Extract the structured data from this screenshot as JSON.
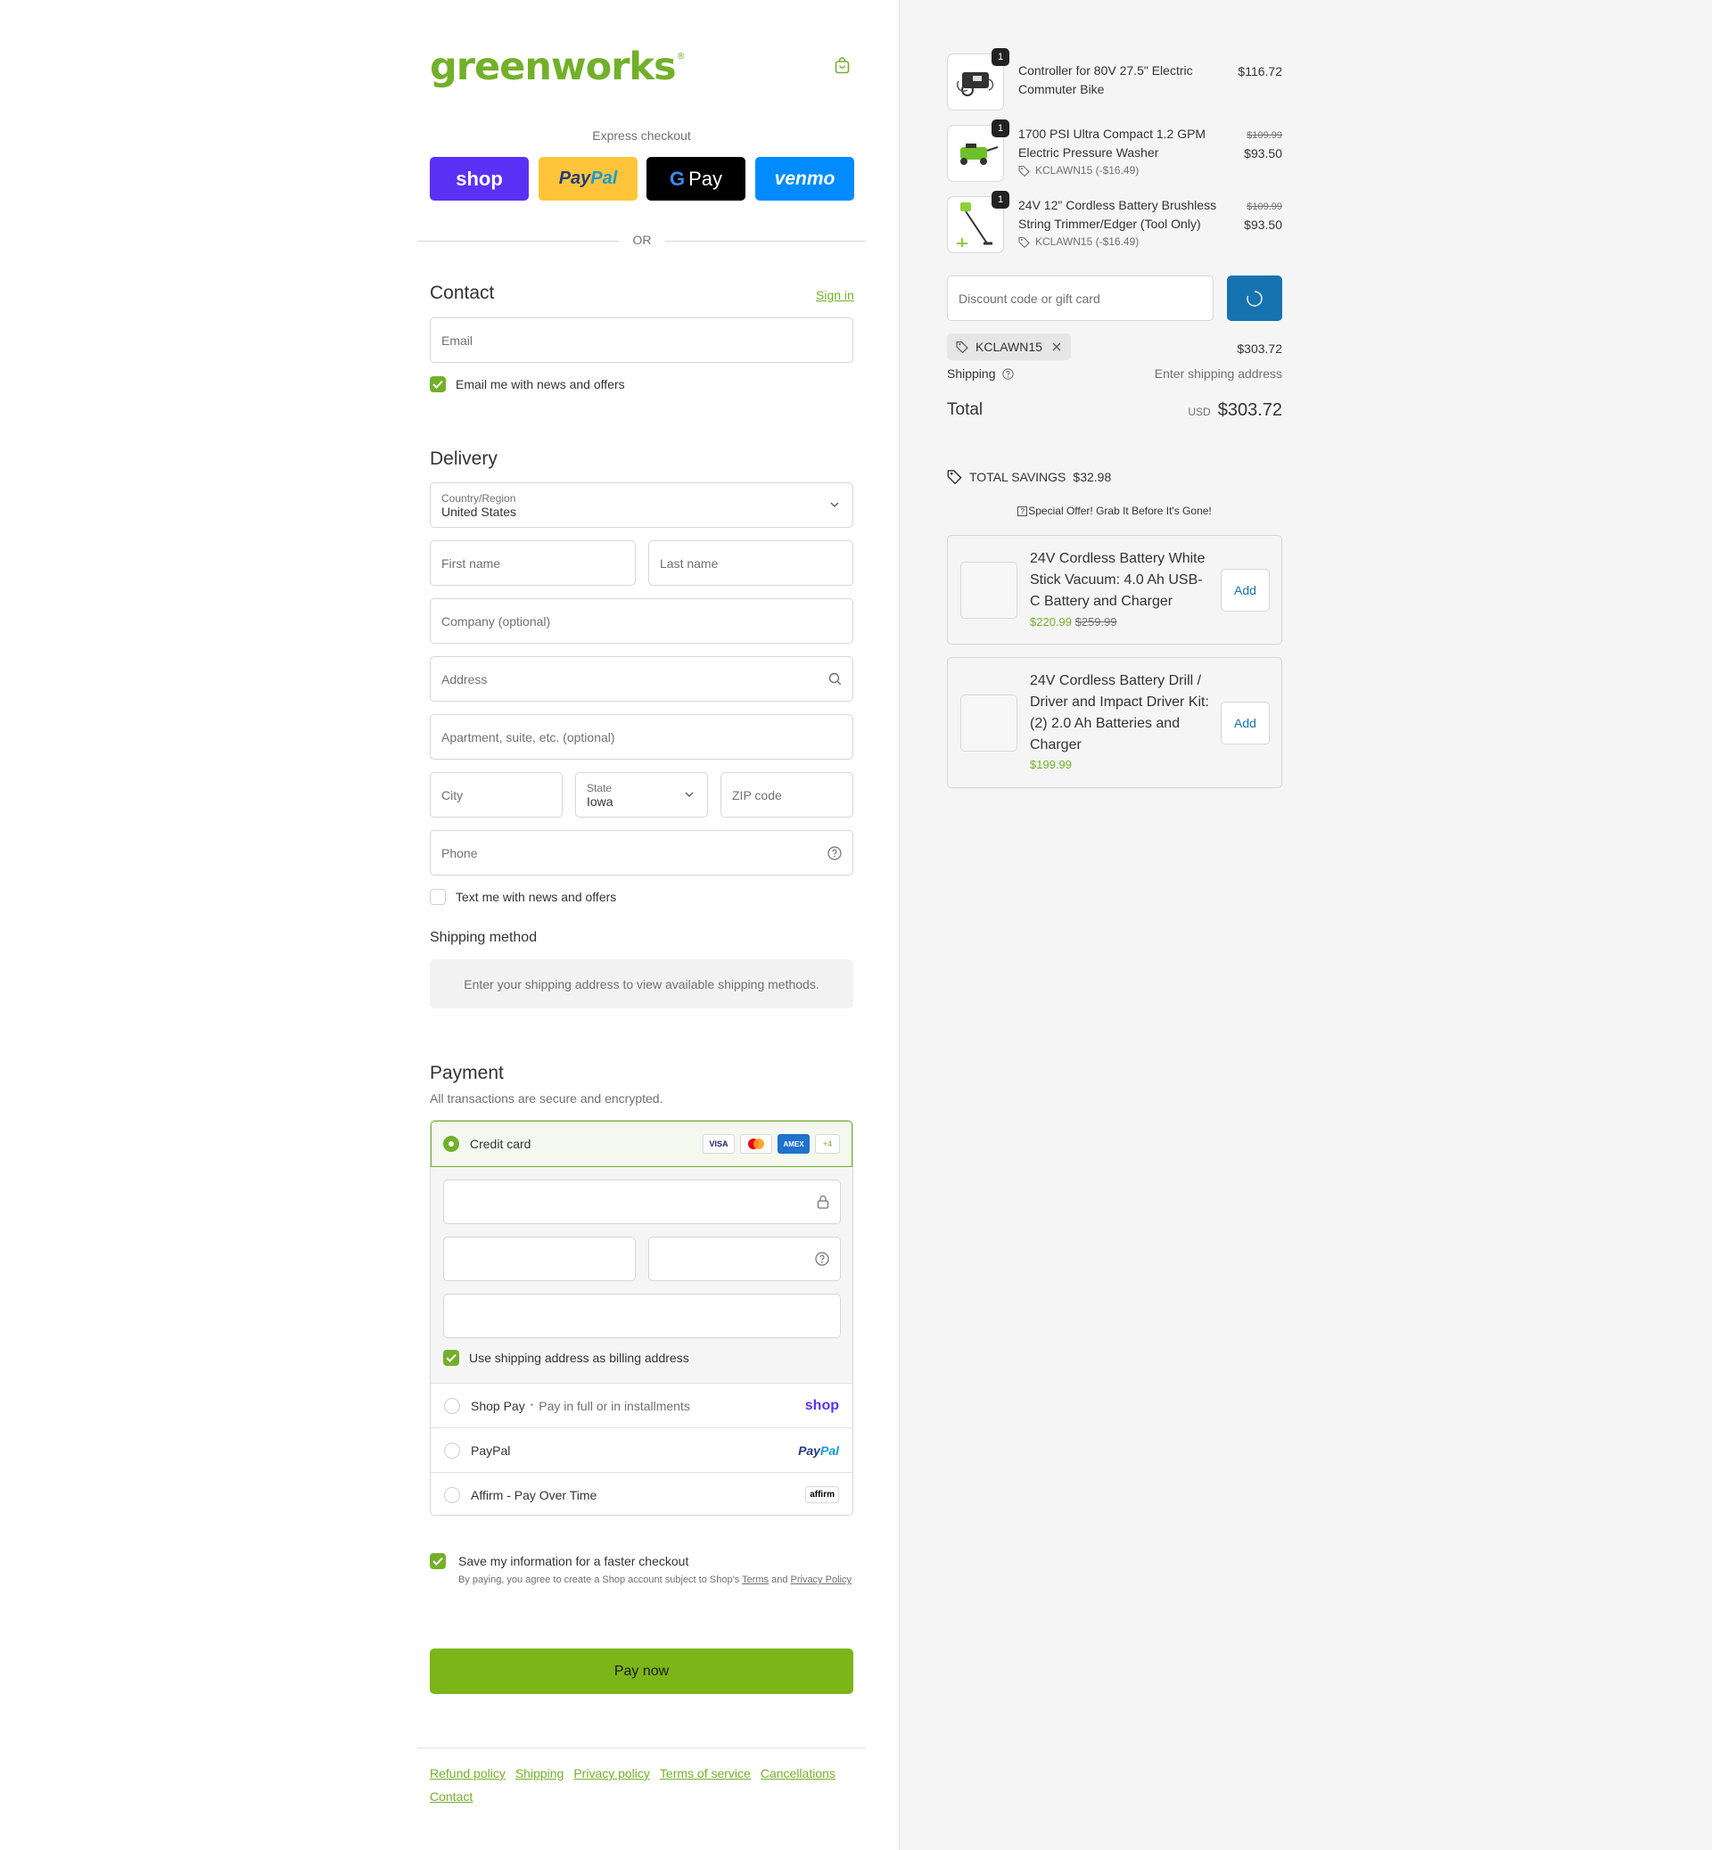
{
  "brand": {
    "logo": "greenworks",
    "logo_mark": "®",
    "accent": "#73b02a"
  },
  "express": {
    "title": "Express checkout",
    "shop_label": "shop",
    "paypal_label_a": "Pay",
    "paypal_label_b": "Pal",
    "gpay_label_g": "G",
    "gpay_label": "Pay",
    "venmo_label": "venmo",
    "or_label": "OR"
  },
  "contact": {
    "heading": "Contact",
    "sign_in": "Sign in",
    "email_placeholder": "Email",
    "news_label": "Email me with news and offers"
  },
  "delivery": {
    "heading": "Delivery",
    "country_label": "Country/Region",
    "country_value": "United States",
    "first_name": "First name",
    "last_name": "Last name",
    "company": "Company (optional)",
    "address": "Address",
    "apartment": "Apartment, suite, etc. (optional)",
    "city": "City",
    "state_label": "State",
    "state_value": "Iowa",
    "zip": "ZIP code",
    "phone": "Phone",
    "text_label": "Text me with news and offers"
  },
  "shipping_method": {
    "heading": "Shipping method",
    "notice": "Enter your shipping address to view available shipping methods."
  },
  "payment": {
    "heading": "Payment",
    "subtitle": "All transactions are secure and encrypted.",
    "credit_card": "Credit card",
    "card_visa": "VISA",
    "card_amex": "AMEX",
    "card_more": "+4",
    "billing_label": "Use shipping address as billing address",
    "shop_pay": "Shop Pay",
    "shop_pay_dot": "•",
    "shop_pay_sub": "Pay in full or in installments",
    "shop_pay_logo": "shop",
    "paypal": "PayPal",
    "paypal_logo_a": "Pay",
    "paypal_logo_b": "Pal",
    "affirm": "Affirm - Pay Over Time",
    "affirm_logo": "affirm"
  },
  "save_info": {
    "label": "Save my information for a faster checkout",
    "legal_prefix": "By paying, you agree to create a Shop account subject to Shop's",
    "terms": "Terms",
    "and": "and",
    "privacy": "Privacy Policy"
  },
  "pay_now": "Pay now",
  "footer": {
    "links": [
      "Refund policy",
      "Shipping",
      "Privacy policy",
      "Terms of service",
      "Cancellations",
      "Contact"
    ]
  },
  "cart": {
    "items": [
      {
        "qty": "1",
        "name": "Controller for 80V 27.5\" Electric Commuter Bike",
        "price": "$116.72"
      },
      {
        "qty": "1",
        "name": "1700 PSI Ultra Compact 1.2 GPM Electric Pressure Washer",
        "original": "$109.99",
        "price": "$93.50",
        "discount": "KCLAWN15 (-$16.49)"
      },
      {
        "qty": "1",
        "name": "24V 12\" Cordless Battery Brushless String Trimmer/Edger (Tool Only)",
        "original": "$109.99",
        "price": "$93.50",
        "discount": "KCLAWN15 (-$16.49)"
      }
    ],
    "discount_placeholder": "Discount code or gift card",
    "applied_code": "KCLAWN15",
    "subtotal": "$303.72",
    "shipping_label": "Shipping",
    "shipping_value": "Enter shipping address",
    "total_label": "Total",
    "currency": "USD",
    "total": "$303.72",
    "savings_label": "TOTAL SAVINGS",
    "savings_value": "$32.98",
    "offer_text": "Special Offer! Grab It Before It's Gone!",
    "offer_icon": "?"
  },
  "recommendations": [
    {
      "name": "24V Cordless Battery White Stick Vacuum: 4.0 Ah USB-C Battery and Charger",
      "price": "$220.99",
      "original": "$259.99",
      "add": "Add"
    },
    {
      "name": "24V Cordless Battery Drill / Driver and Impact Driver Kit: (2) 2.0 Ah Batteries and Charger",
      "price": "$199.99",
      "add": "Add"
    }
  ]
}
